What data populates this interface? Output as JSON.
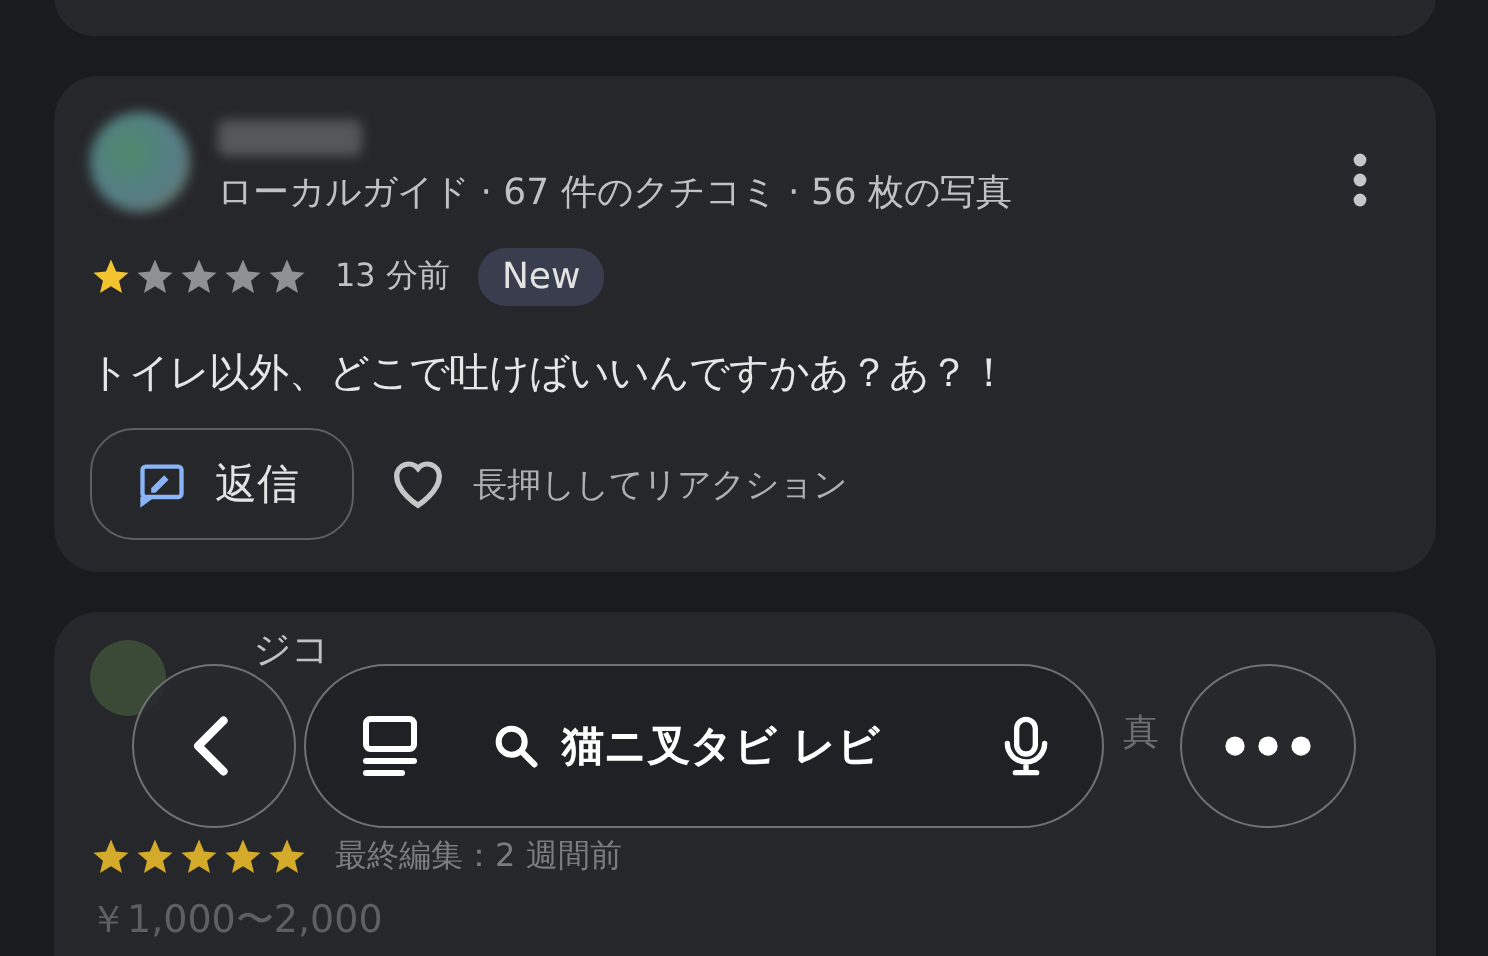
{
  "reviews": [
    {
      "meta": "ローカルガイド · 67 件のクチコミ · 56 枚の写真",
      "stars": 1,
      "time": "13 分前",
      "badge": "New",
      "text": "トイレ以外、どこで吐けばいいんですかあ？あ？！",
      "reply_label": "返信",
      "reaction_hint": "長押ししてリアクション"
    },
    {
      "name": "ジコ",
      "meta_end": "真",
      "stars": 5,
      "time": "最終編集：2 週間前",
      "price": "￥1,000〜2,000"
    }
  ],
  "nav": {
    "search_text": "猫ニ叉タビ レビ"
  }
}
